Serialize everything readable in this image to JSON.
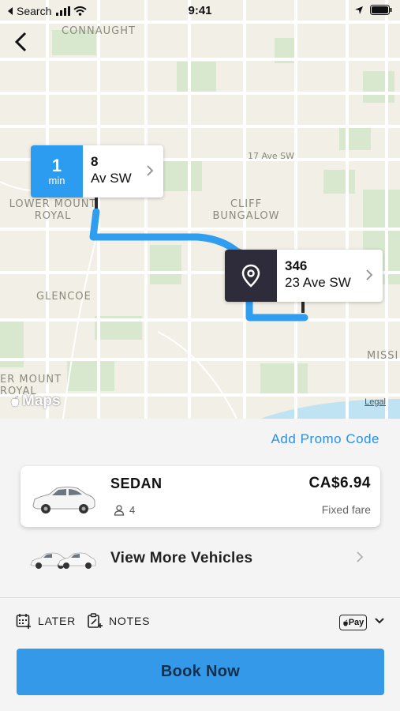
{
  "status_bar": {
    "back_app": "Search",
    "time": "9:41"
  },
  "map": {
    "labels": {
      "connaught": "CONNAUGHT",
      "ave_17": "17 Ave SW",
      "lower_mount_royal_1": "LOWER MOUNT",
      "lower_mount_royal_2": "ROYAL",
      "cliff_bungalow_1": "CLIFF",
      "cliff_bungalow_2": "BUNGALOW",
      "glencoe": "GLENCOE",
      "missi": "MISSI",
      "er_mount_royal_1": "ER MOUNT",
      "er_mount_royal_2": "ROYAL"
    },
    "maps_logo": "Maps",
    "legal": "Legal",
    "route_color": "#2f9df0"
  },
  "pickup": {
    "eta_value": "1",
    "eta_unit": "min",
    "address_line1": "8",
    "address_line2": "Av SW",
    "badge_color": "#2c9cf0"
  },
  "dropoff": {
    "address_line1": "346",
    "address_line2": "23 Ave SW",
    "badge_color": "#2e2c3a",
    "icon": "location-pin-icon"
  },
  "sheet": {
    "promo_label": "Add Promo Code",
    "vehicle": {
      "name": "SEDAN",
      "seats": "4",
      "price": "CA$6.94",
      "fare_type": "Fixed fare"
    },
    "more_vehicles_label": "View More Vehicles",
    "options": {
      "later": "LATER",
      "notes": "NOTES",
      "payment": "Pay"
    },
    "book_label": "Book Now"
  },
  "colors": {
    "accent": "#2c8fe0",
    "book_button": "#3399e8"
  }
}
